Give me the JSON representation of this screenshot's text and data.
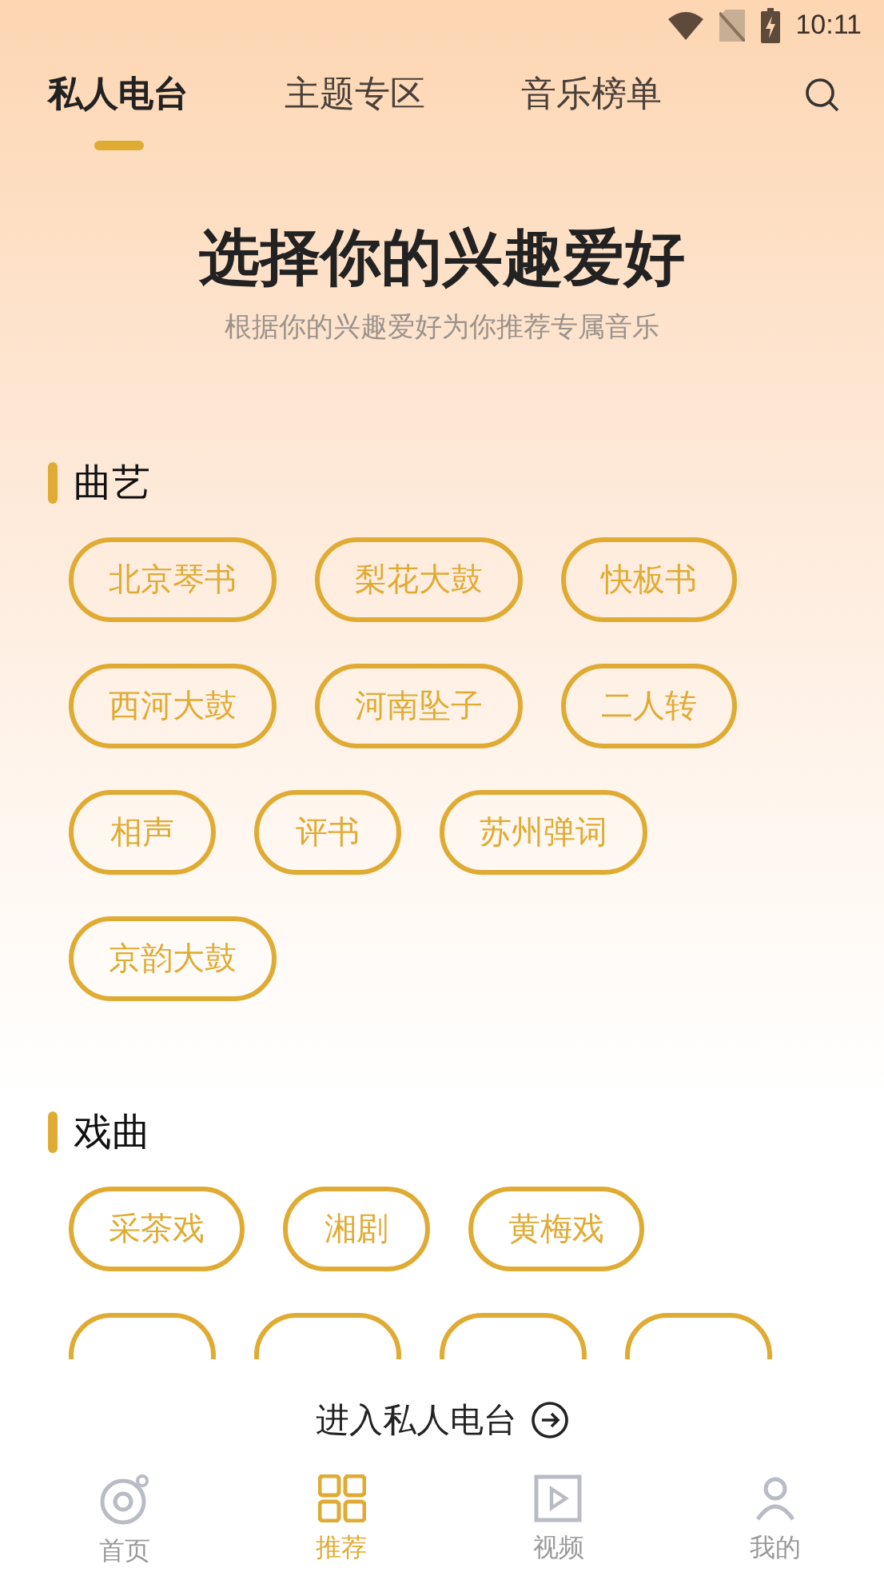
{
  "status_bar": {
    "time": "10:11"
  },
  "tabs": [
    {
      "label": "私人电台",
      "selected": true
    },
    {
      "label": "主题专区",
      "selected": false
    },
    {
      "label": "音乐榜单",
      "selected": false
    }
  ],
  "header": {
    "title": "选择你的兴趣爱好",
    "subtitle": "根据你的兴趣爱好为你推荐专属音乐"
  },
  "sections": [
    {
      "title": "曲艺",
      "tags": [
        {
          "kind": "tag",
          "label": "北京琴书"
        },
        {
          "kind": "tag",
          "label": "梨花大鼓"
        },
        {
          "kind": "tag",
          "label": "快板书"
        },
        {
          "kind": "tag",
          "label": "西河大鼓"
        },
        {
          "kind": "tag",
          "label": "河南坠子"
        },
        {
          "kind": "tag",
          "label": "二人转"
        },
        {
          "kind": "tag",
          "label": "相声"
        },
        {
          "kind": "tag",
          "label": "评书"
        },
        {
          "kind": "tag",
          "label": "苏州弹词"
        },
        {
          "kind": "tag",
          "label": "京韵大鼓"
        }
      ]
    },
    {
      "title": "戏曲",
      "tags": [
        {
          "kind": "tag",
          "label": "采茶戏"
        },
        {
          "kind": "tag",
          "label": "湘剧"
        },
        {
          "kind": "tag",
          "label": "黄梅戏"
        },
        {
          "kind": "clipped"
        },
        {
          "kind": "clipped"
        },
        {
          "kind": "clipped"
        },
        {
          "kind": "clipped"
        }
      ]
    }
  ],
  "enter_button": {
    "label": "进入私人电台"
  },
  "bottom_nav": [
    {
      "kind": "home",
      "label": "首页",
      "selected": false
    },
    {
      "kind": "grid",
      "label": "推荐",
      "selected": true
    },
    {
      "kind": "video",
      "label": "视频",
      "selected": false
    },
    {
      "kind": "profile",
      "label": "我的",
      "selected": false
    }
  ]
}
